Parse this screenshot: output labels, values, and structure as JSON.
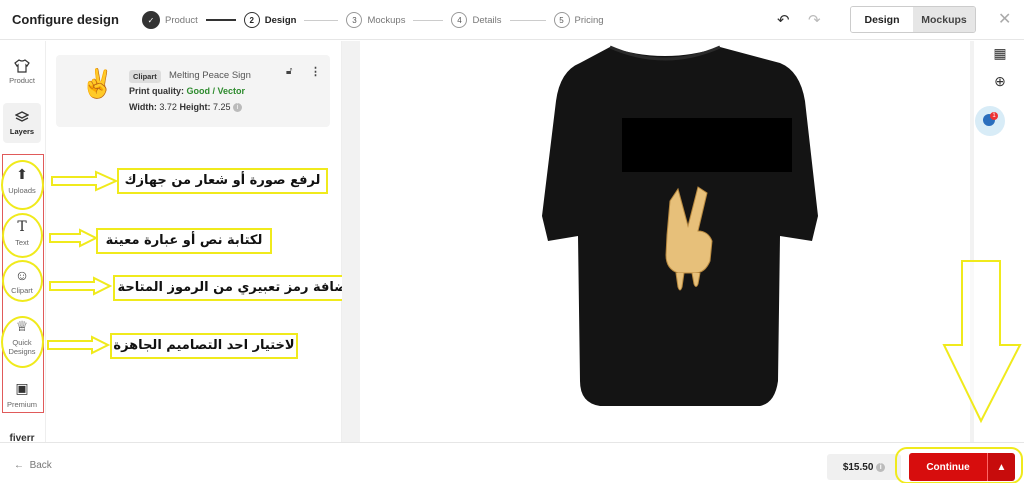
{
  "header": {
    "title": "Configure design",
    "steps": [
      {
        "num": "✓",
        "label": "Product"
      },
      {
        "num": "2",
        "label": "Design"
      },
      {
        "num": "3",
        "label": "Mockups"
      },
      {
        "num": "4",
        "label": "Details"
      },
      {
        "num": "5",
        "label": "Pricing"
      }
    ],
    "toggle": {
      "design": "Design",
      "mockups": "Mockups"
    }
  },
  "rail": {
    "items": [
      {
        "label": "Product"
      },
      {
        "label": "Layers"
      },
      {
        "label": "Uploads"
      },
      {
        "label": "Text"
      },
      {
        "label": "Clipart"
      },
      {
        "label": "Quick Designs"
      },
      {
        "label": "Premium"
      },
      {
        "label": "fiverr"
      }
    ]
  },
  "layer": {
    "chip": "Clipart",
    "name": "Melting Peace Sign",
    "quality_label": "Print quality:",
    "quality_value": "Good / Vector",
    "width_label": "Width:",
    "width_value": "3.72",
    "height_label": "Height:",
    "height_value": "7.25"
  },
  "annotations": {
    "uploads": "لرفع صورة أو شعار من جهازك",
    "text": "لكتابة نص أو عبارة معينة",
    "clipart": "لإضافة رمز تعبيري من الرموز المتاحة",
    "quick": "لاختيار احد التصاميم الجاهزة"
  },
  "footer": {
    "back": "Back",
    "price": "$15.50",
    "continue": "Continue"
  },
  "colors": {
    "accent": "#d70d0d",
    "annotation": "#f0ea1c",
    "shirt": "#141414"
  }
}
